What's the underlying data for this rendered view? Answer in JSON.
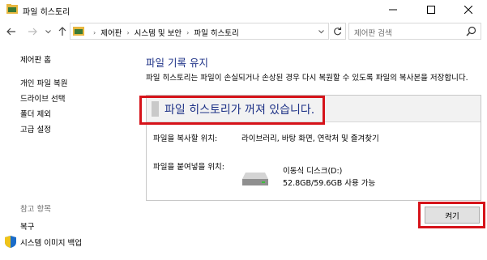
{
  "window": {
    "title": "파일 히스토리"
  },
  "address_bar": {
    "breadcrumbs": [
      "제어판",
      "시스템 및 보안",
      "파일 히스토리"
    ],
    "search_placeholder": "제어판 검색"
  },
  "sidebar": {
    "items": [
      {
        "label": "제어판 홈"
      },
      {
        "label": "개인 파일 복원"
      },
      {
        "label": "드라이브 선택"
      },
      {
        "label": "폴더 제외"
      },
      {
        "label": "고급 설정"
      }
    ],
    "see_also_label": "참고 항목",
    "see_also_items": [
      {
        "label": "복구"
      },
      {
        "label": "시스템 이미지 백업"
      }
    ]
  },
  "main": {
    "heading": "파일 기록 유지",
    "description": "파일 히스토리는 파일이 손실되거나 손상된 경우 다시 복원할 수 있도록 파일의 복사본을 저장합니다.",
    "status": "파일 히스토리가 꺼져 있습니다.",
    "copy_from_label": "파일을 복사할 위치:",
    "copy_from_value": "라이브러리, 바탕 화면, 연락처 및 즐겨찾기",
    "copy_to_label": "파일을 붙여넣을 위치:",
    "drive_name": "이동식 디스크(D:)",
    "drive_space": "52.8GB/59.6GB 사용 가능",
    "turn_on_label": "켜기"
  },
  "colors": {
    "heading": "#1e3287",
    "highlight_box": "#d6131a"
  }
}
